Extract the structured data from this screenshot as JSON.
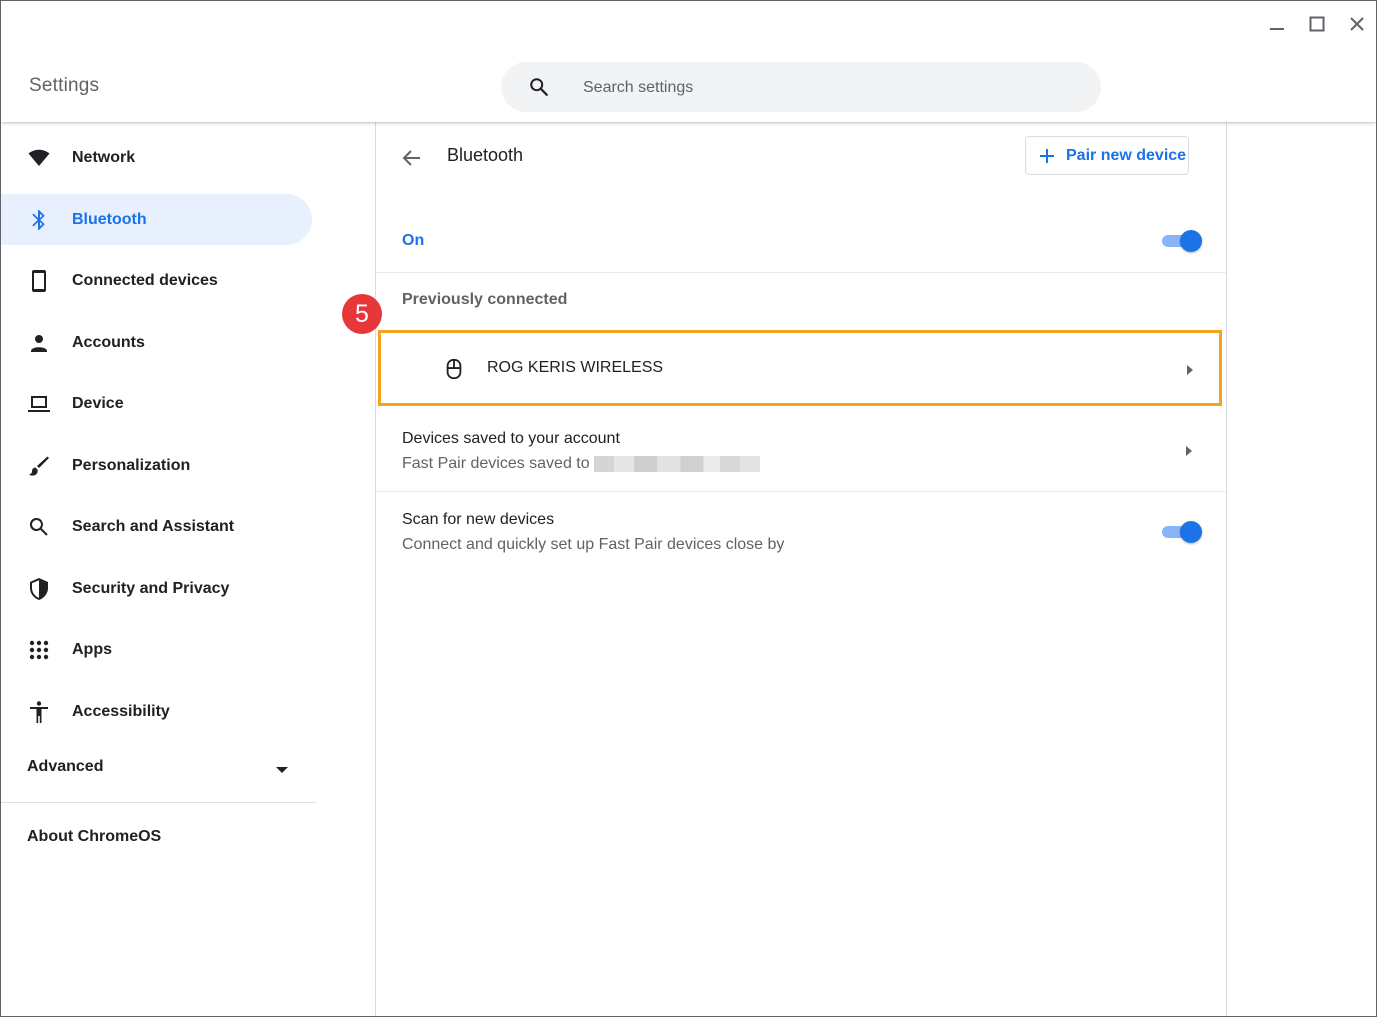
{
  "window": {
    "title": "Settings",
    "controls": [
      "minimize-icon",
      "maximize-icon",
      "close-icon"
    ]
  },
  "search": {
    "placeholder": "Search settings",
    "icon": "search-icon"
  },
  "sidebar": {
    "items": [
      {
        "label": "Network",
        "icon": "wifi-icon",
        "active": false
      },
      {
        "label": "Bluetooth",
        "icon": "bluetooth-icon",
        "active": true
      },
      {
        "label": "Connected devices",
        "icon": "phone-icon",
        "active": false
      },
      {
        "label": "Accounts",
        "icon": "person-icon",
        "active": false
      },
      {
        "label": "Device",
        "icon": "laptop-icon",
        "active": false
      },
      {
        "label": "Personalization",
        "icon": "brush-icon",
        "active": false
      },
      {
        "label": "Search and Assistant",
        "icon": "search-icon",
        "active": false
      },
      {
        "label": "Security and Privacy",
        "icon": "shield-icon",
        "active": false
      },
      {
        "label": "Apps",
        "icon": "apps-grid-icon",
        "active": false
      },
      {
        "label": "Accessibility",
        "icon": "accessibility-icon",
        "active": false
      }
    ],
    "advanced_label": "Advanced",
    "about_label": "About ChromeOS"
  },
  "main": {
    "title": "Bluetooth",
    "pair_button_label": "Pair new device",
    "bluetooth_state_label": "On",
    "bluetooth_enabled": true,
    "previously_connected_label": "Previously connected",
    "devices": [
      {
        "name": "ROG KERIS WIRELESS",
        "icon": "mouse-icon"
      }
    ],
    "saved_devices": {
      "title": "Devices saved to your account",
      "subtitle": "Fast Pair devices saved to"
    },
    "scan": {
      "title": "Scan for new devices",
      "subtitle": "Connect and quickly set up Fast Pair devices close by",
      "enabled": true
    }
  },
  "annotation": {
    "step_number": "5"
  },
  "colors": {
    "accent": "#1a73e8",
    "active_nav_bg": "#e8f0fe",
    "highlight_border": "#f5a51c",
    "step_badge": "#e8373a"
  }
}
